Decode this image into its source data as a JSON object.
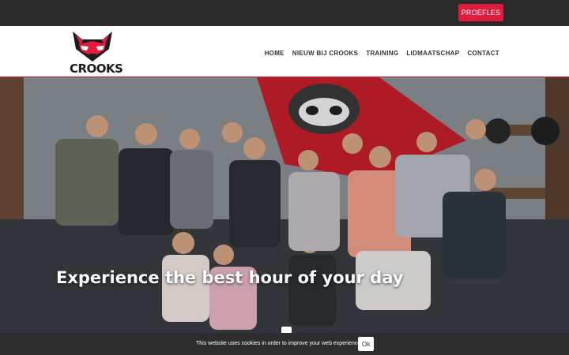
{
  "topbar": {
    "trial_label": "PROEFLES"
  },
  "brand": {
    "name": "CROOKS",
    "accent": "#e01b3c"
  },
  "nav": {
    "items": [
      {
        "label": "HOME"
      },
      {
        "label": "NIEUW BIJ CROOKS"
      },
      {
        "label": "TRAINING"
      },
      {
        "label": "LIDMAATSCHAP"
      },
      {
        "label": "CONTACT"
      }
    ]
  },
  "hero": {
    "title": "Experience the best hour of your day",
    "image_icon": "photo-icon"
  },
  "cookie": {
    "text": "This website uses cookies in order to improve your web experience.",
    "ok_label": "Ok"
  }
}
